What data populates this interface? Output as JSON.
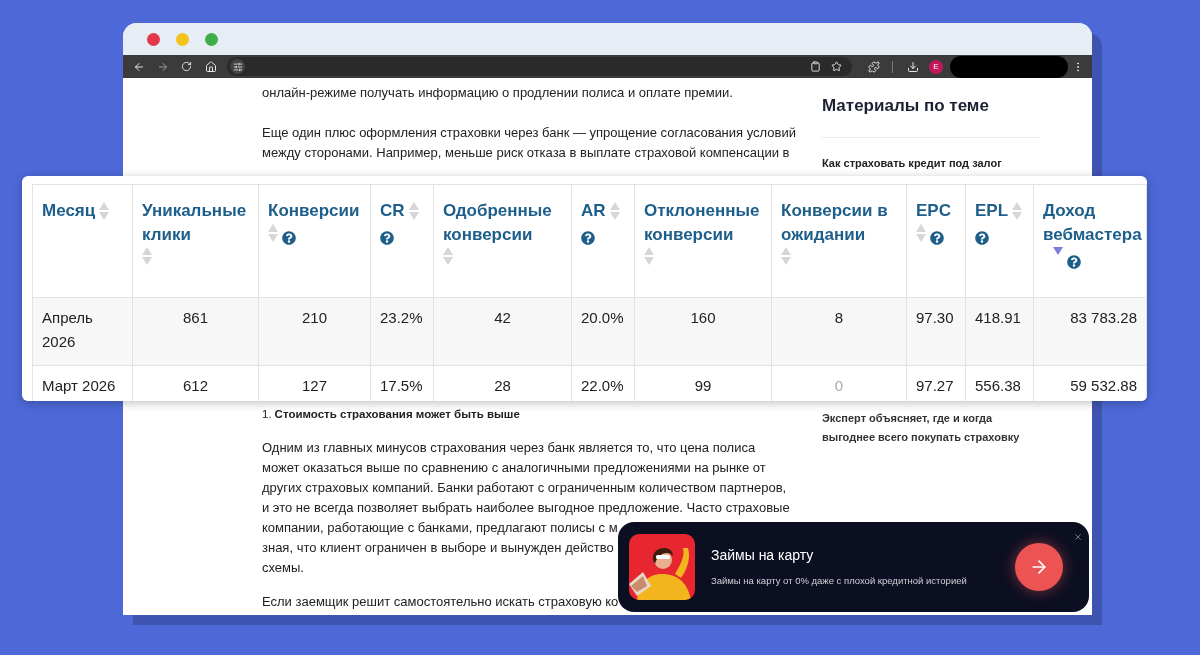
{
  "browser": {
    "avatar_letter": "E"
  },
  "article": {
    "intro_line": "онлайн-режиме получать информацию о продлении полиса и оплате премии.",
    "paragraph_lines": [
      "Еще один плюс оформления страховки через банк — упрощение согласования условий",
      "между сторонами. Например, меньше риск отказа в выплате страховой компенсации в"
    ],
    "list_item": {
      "number": "1.",
      "text": "Стоимость страхования может быть выше"
    },
    "lines_after": [
      "Одним из главных минусов страхования через банк является то, что цена полиса",
      "может оказаться выше по сравнению с аналогичными предложениями на рынке от",
      "других страховых компаний. Банки работают с ограниченным количеством партнеров,",
      "и это не всегда позволяет выбрать наиболее выгодное предложение. Часто страховые",
      "компании, работающие с банками, предлагают полисы с м",
      "зная, что клиент ограничен в выборе и вынужден действо",
      "схемы."
    ],
    "last_line": "Если заемщик решит самостоятельно искать страховую ко"
  },
  "sidebar": {
    "heading": "Материалы по теме",
    "link": "Как страховать кредит под залог",
    "bottom_text": "Эксперт объясняет, где и когда выгоднее всего покупать страховку"
  },
  "table": {
    "columns": [
      {
        "label": "Месяц",
        "sorted_descending": false,
        "help": false
      },
      {
        "label": "Уникальные клики",
        "sorted_descending": false,
        "help": false
      },
      {
        "label": "Конверсии",
        "sorted_descending": false,
        "help": true
      },
      {
        "label": "CR",
        "sorted_descending": false,
        "help": true
      },
      {
        "label": "Одобренные конверсии",
        "sorted_descending": false,
        "help": false
      },
      {
        "label": "AR",
        "sorted_descending": false,
        "help": true
      },
      {
        "label": "Отклоненные конверсии",
        "sorted_descending": false,
        "help": false
      },
      {
        "label": "Конверсии в ожидании",
        "sorted_descending": false,
        "help": false
      },
      {
        "label": "EPC",
        "sorted_descending": false,
        "help": true
      },
      {
        "label": "EPL",
        "sorted_descending": false,
        "help": true
      },
      {
        "label": "Доход вебмастера",
        "sorted_descending": true,
        "help": true
      }
    ],
    "rows": [
      {
        "cells": [
          {
            "text": "Апрель 2026",
            "muted": false
          },
          {
            "text": "861",
            "muted": false
          },
          {
            "text": "210",
            "muted": false
          },
          {
            "text": "23.2%",
            "muted": false
          },
          {
            "text": "42",
            "muted": false
          },
          {
            "text": "20.0%",
            "muted": false
          },
          {
            "text": "160",
            "muted": false
          },
          {
            "text": "8",
            "muted": false
          },
          {
            "text": "97.30",
            "muted": false
          },
          {
            "text": "418.91",
            "muted": false
          },
          {
            "text": "83 783.28",
            "muted": false
          }
        ]
      },
      {
        "cells": [
          {
            "text": "Март 2026",
            "muted": false
          },
          {
            "text": "612",
            "muted": false
          },
          {
            "text": "127",
            "muted": false
          },
          {
            "text": "17.5%",
            "muted": false
          },
          {
            "text": "28",
            "muted": false
          },
          {
            "text": "22.0%",
            "muted": false
          },
          {
            "text": "99",
            "muted": false
          },
          {
            "text": "0",
            "muted": true
          },
          {
            "text": "97.27",
            "muted": false
          },
          {
            "text": "556.38",
            "muted": false
          },
          {
            "text": "59 532.88",
            "muted": false
          }
        ]
      }
    ]
  },
  "ad": {
    "title": "Займы на карту",
    "subtitle": "Займы на карту от 0% даже с плохой кредитной историей"
  }
}
